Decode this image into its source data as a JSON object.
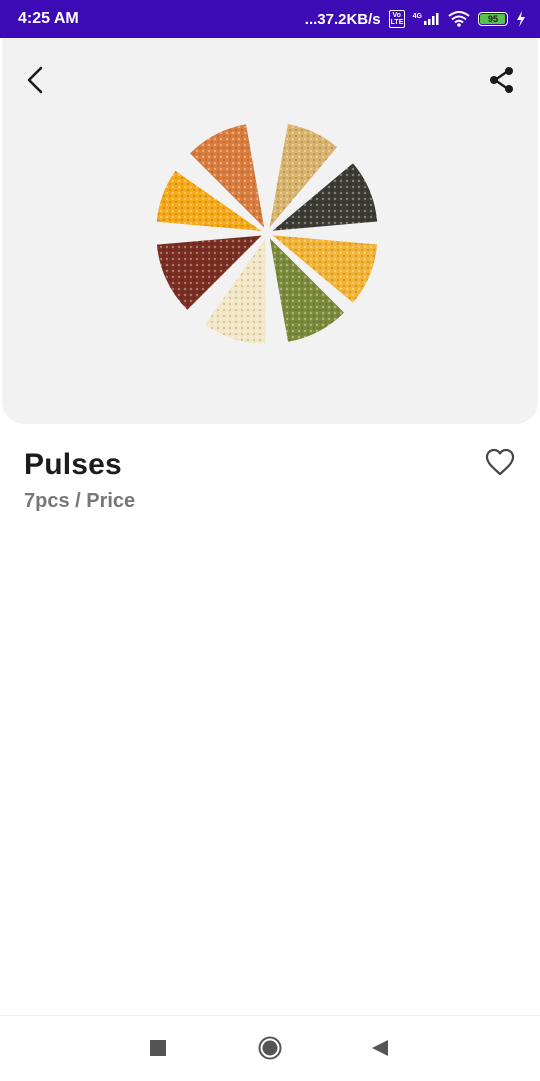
{
  "status_bar": {
    "time": "4:25 AM",
    "speed": "...37.2KB/s",
    "volte": "Vo LTE",
    "network": "4G",
    "battery": "95",
    "battery_level": 0.95
  },
  "product": {
    "title": "Pulses",
    "subtitle": "7pcs / Price",
    "image": "pulses-pie-image"
  },
  "icons": {
    "back": "back-arrow-icon",
    "share": "share-icon",
    "favorite": "heart-outline-icon"
  },
  "colors": {
    "status_bar": "#3d0bb5",
    "hero_background": "#f2f2f2",
    "battery": "#58c24a"
  }
}
